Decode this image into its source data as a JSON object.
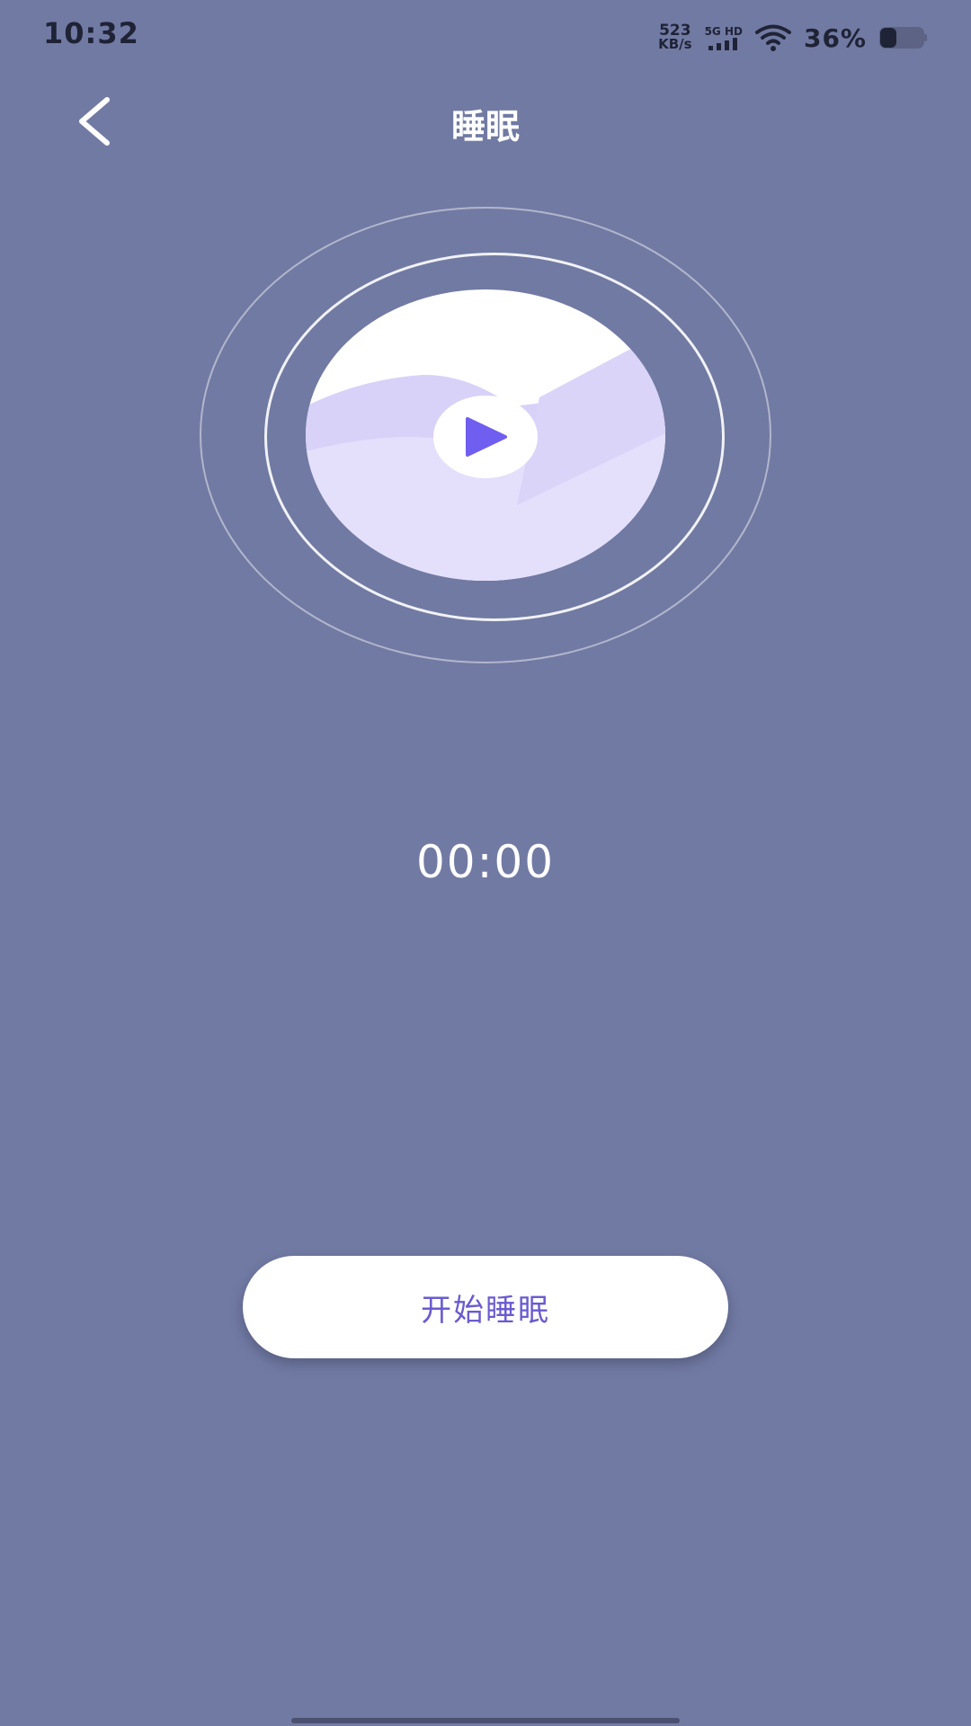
{
  "status_bar": {
    "time": "10:32",
    "net_speed_value": "523",
    "net_speed_unit": "KB/s",
    "network_type": "5G HD",
    "battery_percent": "36%",
    "battery_level": 0.36
  },
  "header": {
    "title": "睡眠",
    "back_icon": "chevron-left-icon"
  },
  "player": {
    "play_icon": "play-icon",
    "accent_color": "#6f5ef0",
    "wave_color_light": "#e3def9",
    "wave_color_dark": "#d5cff7"
  },
  "timer": {
    "value": "00:00"
  },
  "actions": {
    "start_label": "开始睡眠"
  },
  "theme": {
    "background": "#717aa3",
    "button_text": "#6a5bd0"
  }
}
